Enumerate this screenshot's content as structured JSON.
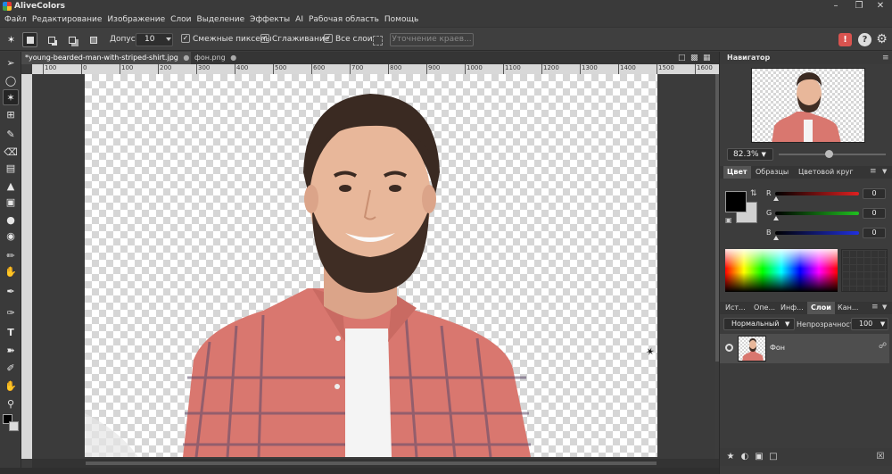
{
  "app": {
    "title": "AliveColors"
  },
  "menu": [
    "Файл",
    "Редактирование",
    "Изображение",
    "Слои",
    "Выделение",
    "Эффекты",
    "AI",
    "Рабочая область",
    "Помощь"
  ],
  "options": {
    "tolerance_label": "Допуск",
    "tolerance_value": "10",
    "contiguous": "Смежные пикселы",
    "antialias": "Сглаживание",
    "all_layers": "Все слои",
    "refine_edge": "Уточнение краев..."
  },
  "tabs": [
    {
      "label": "*young-bearded-man-with-striped-shirt.jpg",
      "active": true
    },
    {
      "label": "фон.png",
      "active": false
    }
  ],
  "ruler": {
    "h_ticks": [
      "100",
      "0",
      "100",
      "200",
      "300",
      "400",
      "500",
      "600",
      "700",
      "800",
      "900",
      "1000",
      "1100",
      "1200",
      "1300",
      "1400",
      "1500",
      "1600"
    ]
  },
  "navigator": {
    "title": "Навигатор",
    "zoom": "82.3%"
  },
  "color_panel": {
    "tabs": [
      "Цвет",
      "Образцы",
      "Цветовой круг"
    ],
    "channels": [
      {
        "label": "R",
        "value": "0",
        "color": "#e02020"
      },
      {
        "label": "G",
        "value": "0",
        "color": "#20c020"
      },
      {
        "label": "B",
        "value": "0",
        "color": "#2030e0"
      }
    ],
    "foreground": "#000000",
    "background": "#d0d0d0"
  },
  "layers_panel": {
    "tabs": [
      "Ист...",
      "Опе...",
      "Инф...",
      "Слои",
      "Кан..."
    ],
    "active_tab": "Слои",
    "blend_mode": "Нормальный",
    "opacity_label": "Непрозрачность",
    "opacity_value": "100",
    "layers": [
      {
        "name": "Фон"
      }
    ]
  },
  "colors": {
    "accent_alert": "#d9534f",
    "shirt": "#d9776f",
    "skin": "#e8b79a",
    "hair": "#3a2a22"
  }
}
